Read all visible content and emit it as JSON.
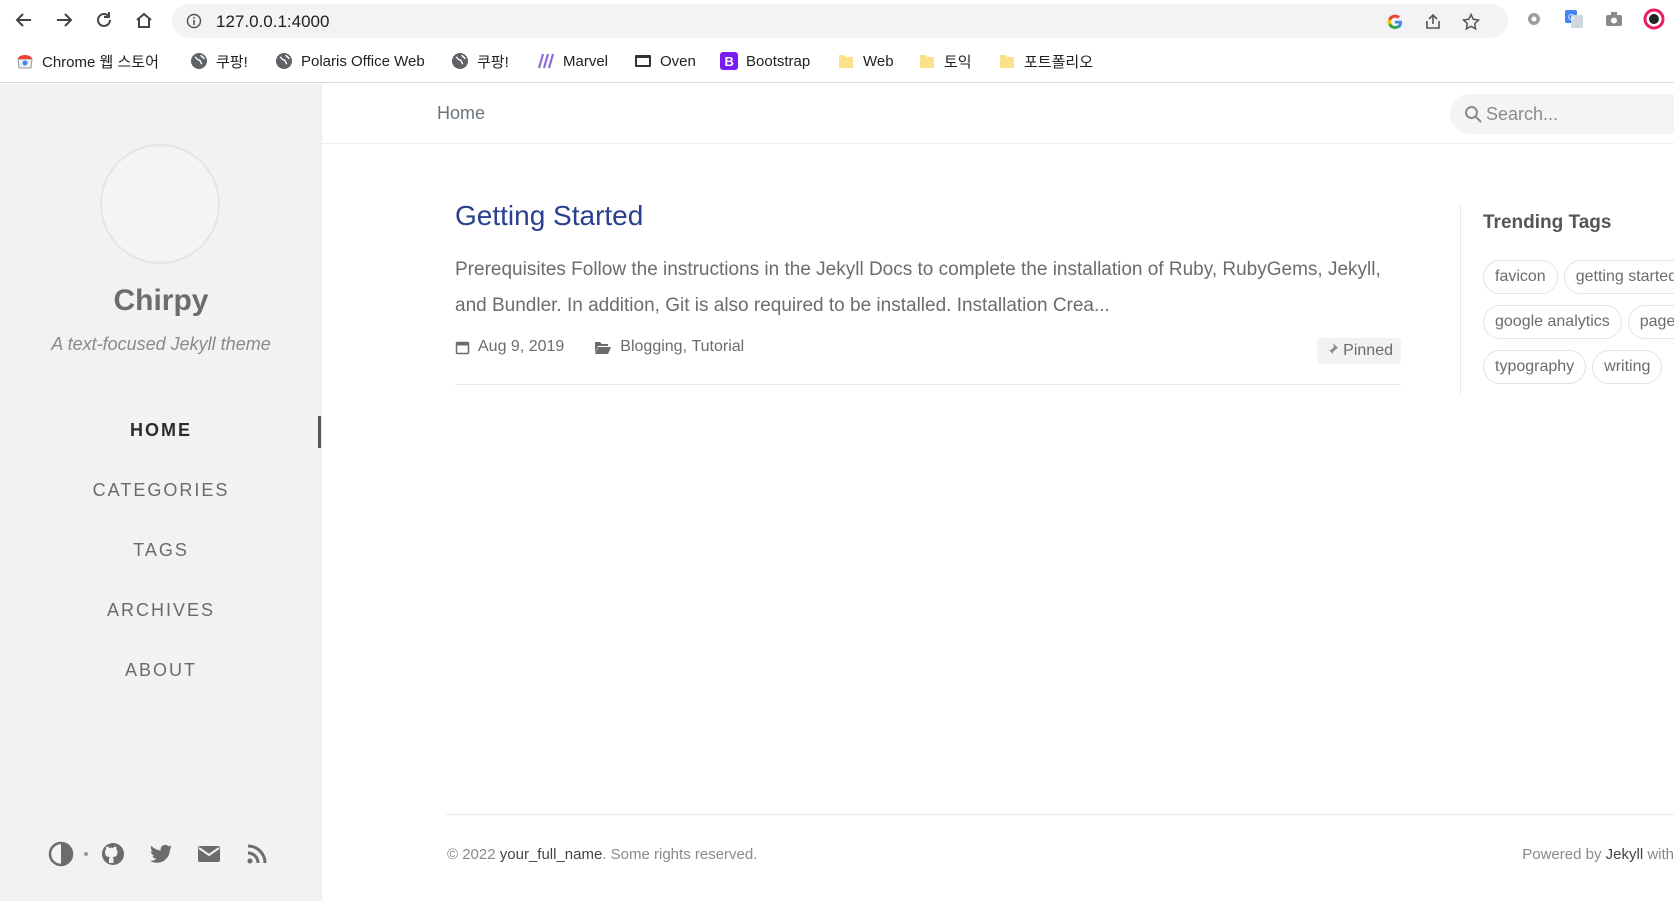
{
  "browser": {
    "url": "127.0.0.1:4000",
    "bookmarks": [
      {
        "label": "Chrome 웹 스토어",
        "icon": "chrome-webstore-icon"
      },
      {
        "label": "쿠팡!",
        "icon": "globe-icon"
      },
      {
        "label": "Polaris Office Web",
        "icon": "globe-icon"
      },
      {
        "label": "쿠팡!",
        "icon": "globe-icon"
      },
      {
        "label": "Marvel",
        "icon": "marvel-icon"
      },
      {
        "label": "Oven",
        "icon": "oven-icon"
      },
      {
        "label": "Bootstrap",
        "icon": "bootstrap-icon"
      },
      {
        "label": "Web",
        "icon": "folder-icon"
      },
      {
        "label": "토익",
        "icon": "folder-icon"
      },
      {
        "label": "포트폴리오",
        "icon": "folder-icon"
      }
    ]
  },
  "sidebar": {
    "title": "Chirpy",
    "subtitle": "A text-focused Jekyll theme",
    "nav": [
      "HOME",
      "CATEGORIES",
      "TAGS",
      "ARCHIVES",
      "ABOUT"
    ],
    "active_index": 0
  },
  "topbar": {
    "breadcrumb": "Home",
    "search_placeholder": "Search..."
  },
  "post": {
    "title": "Getting Started",
    "excerpt": "Prerequisites Follow the instructions in the Jekyll Docs to complete the installation of Ruby, RubyGems, Jekyll, and Bundler. In addition, Git is also required to be installed. Installation Crea...",
    "date": "Aug 9, 2019",
    "categories": [
      "Blogging",
      "Tutorial"
    ],
    "category_sep": ", ",
    "pinned_label": "Pinned"
  },
  "trending": {
    "title": "Trending Tags",
    "rows": [
      [
        "favicon",
        "getting started"
      ],
      [
        "google analytics",
        "pageviews"
      ],
      [
        "typography",
        "writing"
      ]
    ]
  },
  "footer": {
    "copyright_prefix": "© 2022 ",
    "name": "your_full_name",
    "rights": ". Some rights reserved.",
    "powered_prefix": "Powered by ",
    "powered_link": "Jekyll",
    "powered_suffix": " with"
  },
  "colors": {
    "link": "#2a408e",
    "sidebar_bg": "#f2f2f2"
  }
}
